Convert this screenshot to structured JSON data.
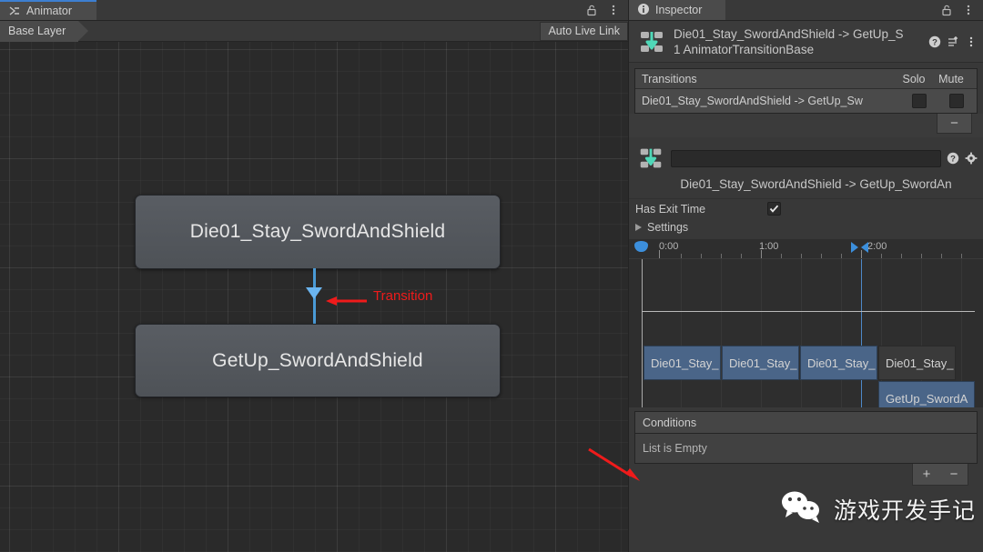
{
  "animator": {
    "tab": {
      "label": "Animator",
      "icon": "animator-icon"
    },
    "toolbar": {
      "lock_icon": "lock-icon",
      "menu_icon": "kebab-menu-icon"
    },
    "layer_breadcrumb": "Base Layer",
    "auto_live_link": "Auto Live Link",
    "states": [
      {
        "id": "die",
        "label": "Die01_Stay_SwordAndShield"
      },
      {
        "id": "getup",
        "label": "GetUp_SwordAndShield"
      }
    ],
    "annotations": [
      {
        "id": "transition",
        "label": "Transition",
        "color": "#ef1b1b"
      }
    ]
  },
  "inspector": {
    "tab": {
      "label": "Inspector",
      "icon": "info-icon"
    },
    "toolbar": {
      "lock_icon": "lock-icon",
      "menu_icon": "kebab-menu-icon"
    },
    "header": {
      "icon": "animator-transition-icon",
      "title": "Die01_Stay_SwordAndShield -> GetUp_S",
      "subtitle": "1 AnimatorTransitionBase",
      "help_icon": "help-icon",
      "preset_icon": "preset-icon",
      "menu_icon": "kebab-menu-icon"
    },
    "transitions_list": {
      "header": {
        "title": "Transitions",
        "solo": "Solo",
        "mute": "Mute"
      },
      "rows": [
        {
          "name": "Die01_Stay_SwordAndShield -> GetUp_Sw",
          "solo": false,
          "mute": false
        }
      ],
      "remove_button": "−"
    },
    "transition_detail": {
      "icon": "animator-transition-icon",
      "name_value": "",
      "name_placeholder": "",
      "help_icon": "help-icon",
      "settings_icon": "gear-icon",
      "subname": "Die01_Stay_SwordAndShield -> GetUp_SwordAn",
      "has_exit_time_label": "Has Exit Time",
      "has_exit_time_checked": true,
      "settings_foldout": "Settings"
    },
    "timeline": {
      "ruler_labels": [
        "0:00",
        "1:00",
        "2:00"
      ],
      "playhead_label": "0:00",
      "clips_row1": [
        {
          "label": "Die01_Stay_",
          "style": "blue"
        },
        {
          "label": "Die01_Stay_",
          "style": "blue"
        },
        {
          "label": "Die01_Stay_",
          "style": "blue"
        },
        {
          "label": "Die01_Stay_",
          "style": "grey"
        }
      ],
      "clips_row2": [
        {
          "label": "GetUp_SwordA",
          "style": "blue"
        }
      ]
    },
    "conditions": {
      "title": "Conditions",
      "empty_text": "List is Empty",
      "add_button": "+",
      "remove_button": "−"
    }
  },
  "watermark": {
    "icon": "wechat-icon",
    "text": "游戏开发手记"
  }
}
